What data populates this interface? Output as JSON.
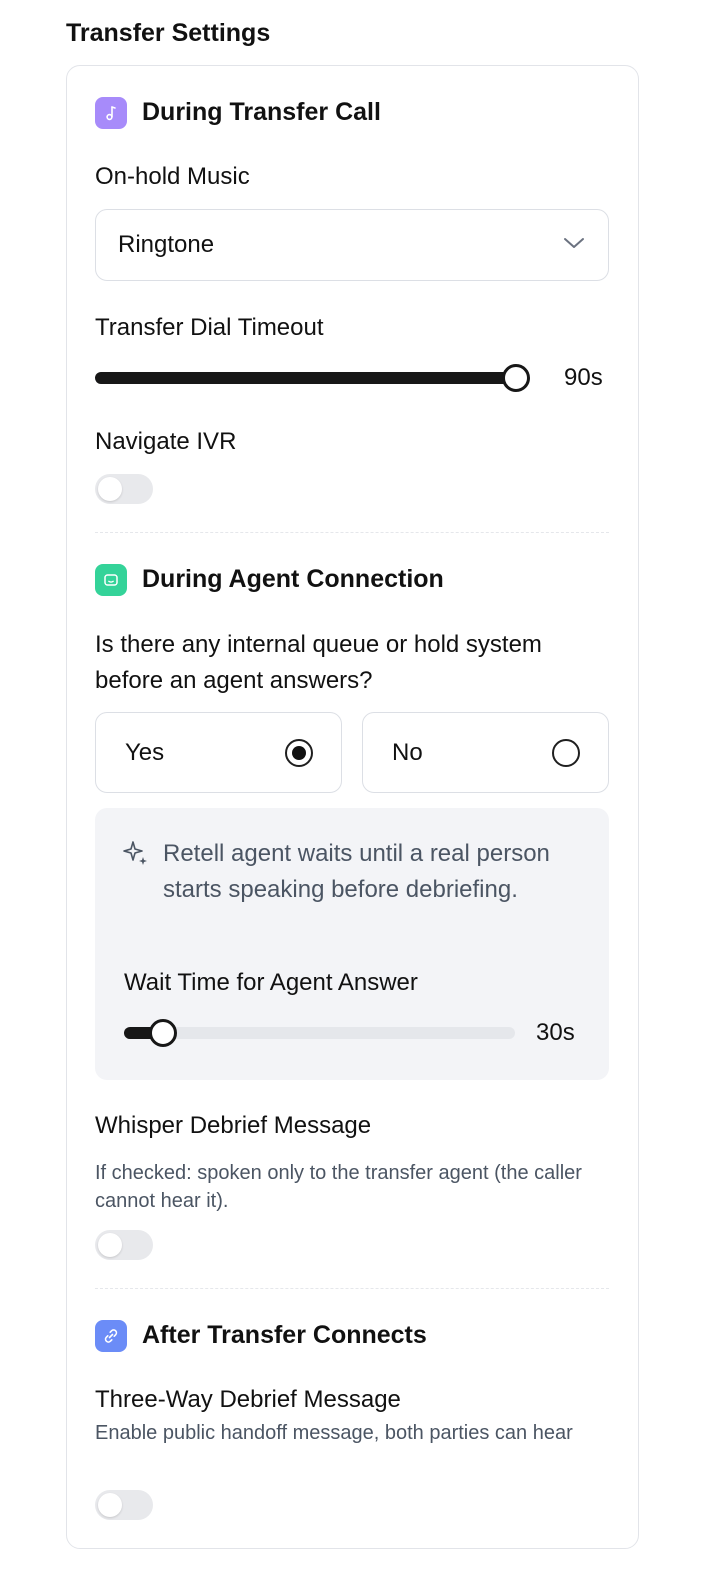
{
  "page_title": "Transfer Settings",
  "during_transfer": {
    "title": "During Transfer Call",
    "icon": "music-note-icon",
    "icon_color": "#a78bfa",
    "on_hold_label": "On-hold Music",
    "on_hold_value": "Ringtone",
    "timeout_label": "Transfer Dial Timeout",
    "timeout_value": "90s",
    "timeout_fraction": 1.0,
    "ivr_label": "Navigate IVR",
    "ivr_enabled": false
  },
  "agent_connection": {
    "title": "During Agent Connection",
    "icon": "chat-bot-icon",
    "icon_color": "#34d399",
    "question": "Is there any internal queue or hold system before an agent answers?",
    "options": [
      {
        "label": "Yes",
        "selected": true
      },
      {
        "label": "No",
        "selected": false
      }
    ],
    "info_text": "Retell agent waits until a real person starts speaking before debriefing.",
    "wait_label": "Wait Time for Agent Answer",
    "wait_value": "30s",
    "wait_fraction": 0.1,
    "whisper_label": "Whisper Debrief Message",
    "whisper_desc": "If checked: spoken only to the transfer agent (the caller cannot hear it).",
    "whisper_enabled": false
  },
  "after_transfer": {
    "title": "After Transfer Connects",
    "icon": "link-icon",
    "icon_color": "#6b8cf7",
    "three_way_label": "Three-Way Debrief Message",
    "three_way_desc": "Enable public handoff message, both parties can hear",
    "three_way_enabled": false
  }
}
